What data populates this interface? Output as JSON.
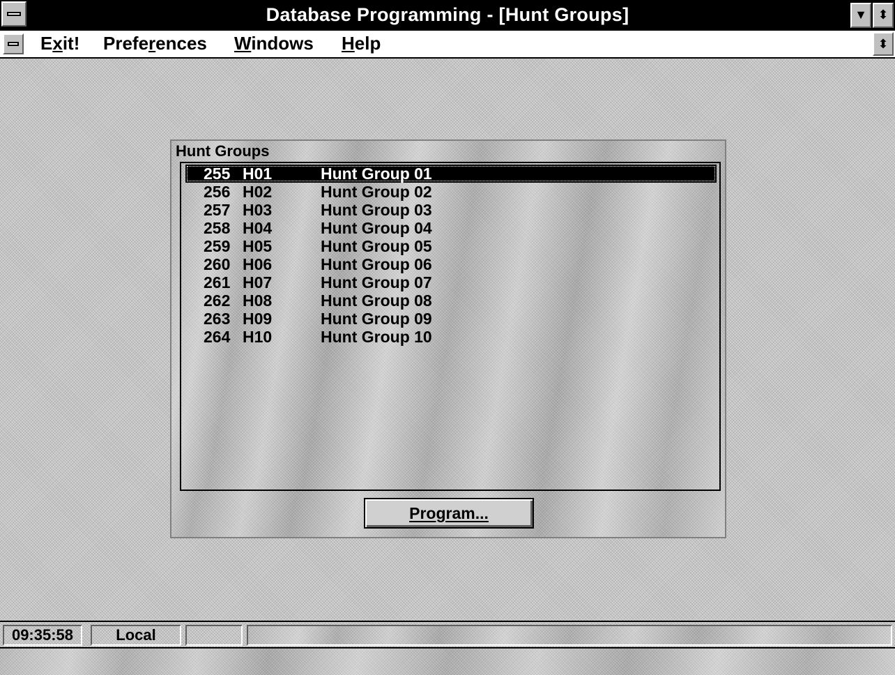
{
  "window": {
    "title": "Database Programming - [Hunt Groups]"
  },
  "menu": {
    "exit": {
      "pre": "E",
      "u": "x",
      "post": "it!"
    },
    "preferences": {
      "pre": "Prefe",
      "u": "r",
      "post": "ences"
    },
    "windows": {
      "pre": "",
      "u": "W",
      "post": "indows"
    },
    "help": {
      "pre": "",
      "u": "H",
      "post": "elp"
    }
  },
  "dialog": {
    "title": "Hunt Groups",
    "rows": [
      {
        "num": "255",
        "code": "H01",
        "name": "Hunt Group 01",
        "selected": true
      },
      {
        "num": "256",
        "code": "H02",
        "name": "Hunt Group 02"
      },
      {
        "num": "257",
        "code": "H03",
        "name": "Hunt Group 03"
      },
      {
        "num": "258",
        "code": "H04",
        "name": "Hunt Group 04"
      },
      {
        "num": "259",
        "code": "H05",
        "name": "Hunt Group 05"
      },
      {
        "num": "260",
        "code": "H06",
        "name": "Hunt Group 06"
      },
      {
        "num": "261",
        "code": "H07",
        "name": "Hunt Group 07"
      },
      {
        "num": "262",
        "code": "H08",
        "name": "Hunt Group 08"
      },
      {
        "num": "263",
        "code": "H09",
        "name": "Hunt Group 09"
      },
      {
        "num": "264",
        "code": "H10",
        "name": "Hunt Group 10"
      }
    ],
    "program_button": "Program..."
  },
  "status": {
    "time": "09:35:58",
    "mode": "Local",
    "field3": ""
  },
  "icons": [
    "system-menu-icon",
    "minimize-arrow-icon",
    "restore-arrow-icon",
    "document-menu-icon",
    "document-restore-icon"
  ]
}
